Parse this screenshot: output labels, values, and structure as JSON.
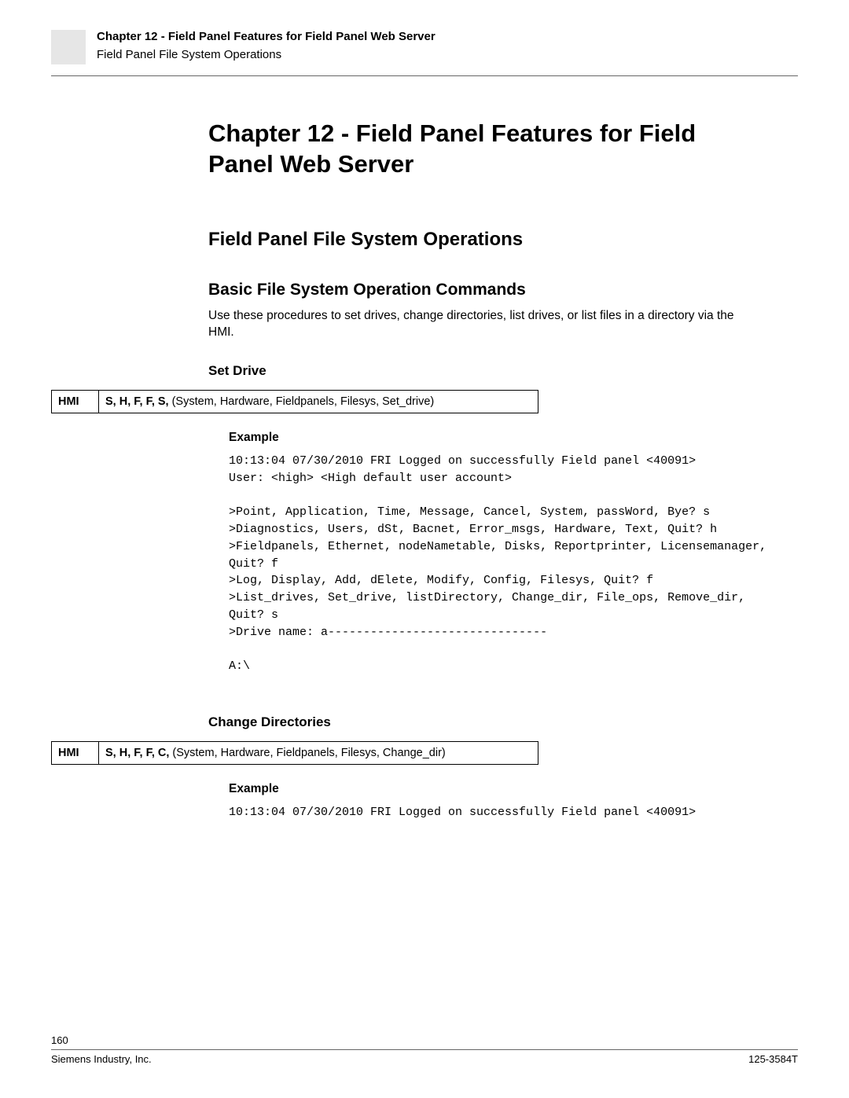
{
  "header": {
    "title": "Chapter 12 - Field Panel Features for Field Panel Web Server",
    "subtitle": "Field Panel File System Operations"
  },
  "chapter_title": "Chapter 12 - Field Panel Features for Field Panel Web Server",
  "section_title": "Field Panel File System Operations",
  "subsection_title": "Basic File System Operation Commands",
  "intro_paragraph": "Use these procedures to set drives, change directories, list drives, or list files in a directory via the HMI.",
  "set_drive": {
    "heading": "Set Drive",
    "hmi_label": "HMI",
    "keys": "S, H, F, F, S,",
    "keys_explain": " (System, Hardware, Fieldpanels, Filesys, Set_drive)",
    "example_label": "Example",
    "lines": [
      "10:13:04 07/30/2010 FRI Logged on successfully Field panel <40091>",
      "User: <high> <High default user account>",
      "",
      ">Point, Application, Time, Message, Cancel, System, passWord, Bye? s",
      ">Diagnostics, Users, dSt, Bacnet, Error_msgs, Hardware, Text, Quit? h",
      ">Fieldpanels, Ethernet, nodeNametable, Disks, Reportprinter, Licensemanager, Quit? f",
      ">Log, Display, Add, dElete, Modify, Config, Filesys, Quit? f",
      ">List_drives, Set_drive, listDirectory, Change_dir, File_ops, Remove_dir, Quit? s",
      ">Drive name: a-------------------------------",
      "",
      "A:\\"
    ]
  },
  "change_dirs": {
    "heading": "Change Directories",
    "hmi_label": "HMI",
    "keys": "S, H, F, F, C,",
    "keys_explain": " (System, Hardware, Fieldpanels, Filesys, Change_dir)",
    "example_label": "Example",
    "lines": [
      "10:13:04 07/30/2010 FRI Logged on successfully Field panel <40091>"
    ]
  },
  "footer": {
    "page": "160",
    "left": "Siemens Industry, Inc.",
    "right": "125-3584T"
  }
}
